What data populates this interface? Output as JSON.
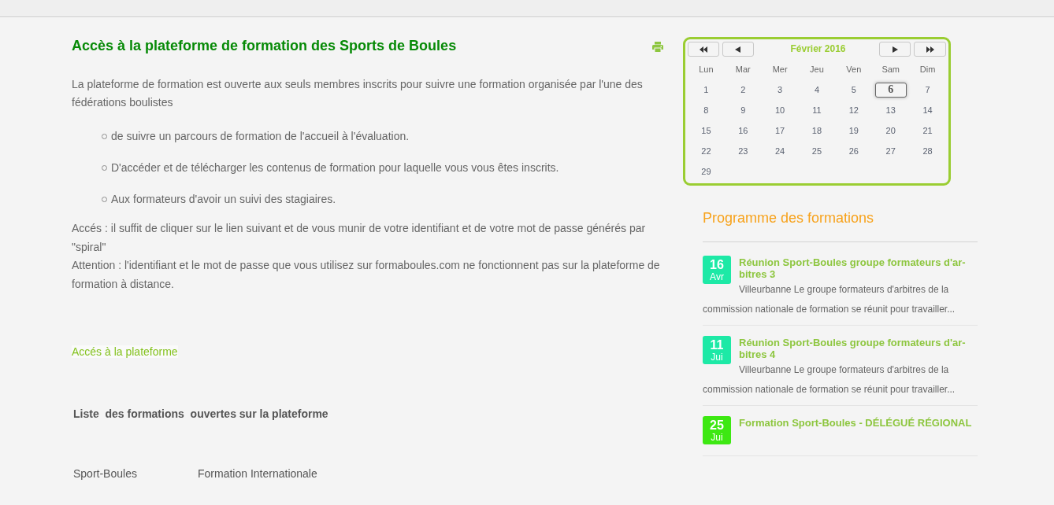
{
  "page": {
    "title": "Accès à la plateforme de formation des Sports de Boules",
    "intro": "La plateforme de formation est ouverte aux seuls membres inscrits pour suivre une formation organisée par l'une des fédérations boulistes",
    "bullets": [
      "de suivre un parcours de formation de l'accueil à l'évaluation.",
      "D'accéder et de télécharger les contenus de formation pour laquelle vous vous êtes inscrits.",
      "Aux formateurs d'avoir un suivi des stagiaires."
    ],
    "notes": [
      "Accés : il suffit de cliquer sur le lien suivant et de vous munir de votre identifiant et de votre mot de passe générés par \"spiral\"",
      "Attention : l'identifiant et le mot de passe que vous utilisez sur formaboules.com ne fonctionnent pas sur la plateforme de formation à distance."
    ],
    "link": "Accés à la plateforme",
    "list_heading": "Liste  des formations  ouvertes sur la plateforme",
    "table": {
      "rows": [
        [
          "Sport-Boules",
          "Formation Internationale"
        ]
      ]
    }
  },
  "calendar": {
    "title": "Février 2016",
    "weekdays": [
      "Lun",
      "Mar",
      "Mer",
      "Jeu",
      "Ven",
      "Sam",
      "Dim"
    ],
    "days": [
      {
        "label": "1",
        "selected": false
      },
      {
        "label": "2",
        "selected": false
      },
      {
        "label": "3",
        "selected": false
      },
      {
        "label": "4",
        "selected": false
      },
      {
        "label": "5",
        "selected": false
      },
      {
        "label": "6",
        "selected": true
      },
      {
        "label": "7",
        "selected": false
      },
      {
        "label": "8",
        "selected": false
      },
      {
        "label": "9",
        "selected": false
      },
      {
        "label": "10",
        "selected": false
      },
      {
        "label": "11",
        "selected": false
      },
      {
        "label": "12",
        "selected": false
      },
      {
        "label": "13",
        "selected": false
      },
      {
        "label": "14",
        "selected": false
      },
      {
        "label": "15",
        "selected": false
      },
      {
        "label": "16",
        "selected": false
      },
      {
        "label": "17",
        "selected": false
      },
      {
        "label": "18",
        "selected": false
      },
      {
        "label": "19",
        "selected": false
      },
      {
        "label": "20",
        "selected": false
      },
      {
        "label": "21",
        "selected": false
      },
      {
        "label": "22",
        "selected": false
      },
      {
        "label": "23",
        "selected": false
      },
      {
        "label": "24",
        "selected": false
      },
      {
        "label": "25",
        "selected": false
      },
      {
        "label": "26",
        "selected": false
      },
      {
        "label": "27",
        "selected": false
      },
      {
        "label": "28",
        "selected": false
      },
      {
        "label": "29",
        "selected": false
      }
    ]
  },
  "sidebar": {
    "title": "Programme des formations",
    "events": [
      {
        "day": "16",
        "month": "Avr",
        "color": "#1de9a6",
        "title": "Réunion Sport-Boules groupe formateurs d'ar-bitres 3",
        "description": "Villeurbanne Le groupe formateurs d'arbitres de la commission nationale de formation se réunit pour travailler..."
      },
      {
        "day": "11",
        "month": "Jui",
        "color": "#1de9a6",
        "title": "Réunion Sport-Boules groupe formateurs d'ar-bitres 4",
        "description": "Villeurbanne Le groupe formateurs d'arbitres de la commission nationale de formation se réunit pour travailler..."
      },
      {
        "day": "25",
        "month": "Jui",
        "color": "#3de812",
        "title": "Formation Sport-Boules - DÉLÉGUÉ RÉGIONAL"
      }
    ]
  }
}
